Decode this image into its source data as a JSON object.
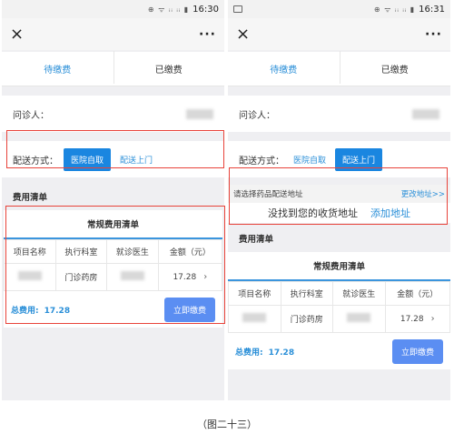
{
  "left": {
    "status": {
      "time": "16:30",
      "icons": "⊕ ᯤ ᵢᵢ ᵢᵢ ▮"
    },
    "nav": {
      "close": "×",
      "more": "···"
    },
    "tabs": [
      {
        "label": "待缴费"
      },
      {
        "label": "已缴费"
      }
    ],
    "patient_label": "问诊人：",
    "delivery": {
      "label": "配送方式：",
      "option_self": "医院自取",
      "option_home": "配送上门",
      "selected": "医院自取"
    },
    "section_title": "费用清单",
    "card_title": "常规费用清单",
    "table": {
      "headers": [
        "项目名称",
        "执行科室",
        "就诊医生",
        "金额（元）"
      ],
      "rows": [
        {
          "name": "",
          "dept": "门诊药房",
          "doctor": "",
          "amount": "17.28"
        }
      ]
    },
    "total": {
      "label": "总费用:",
      "value": "17.28"
    },
    "pay_button": "立即缴费"
  },
  "right": {
    "status": {
      "time": "16:31",
      "icons": "⊕ ᯤ ᵢᵢ ᵢᵢ ▮"
    },
    "nav": {
      "close": "×",
      "more": "···"
    },
    "tabs": [
      {
        "label": "待缴费"
      },
      {
        "label": "已缴费"
      }
    ],
    "patient_label": "问诊人：",
    "delivery": {
      "label": "配送方式：",
      "option_self": "医院自取",
      "option_home": "配送上门",
      "selected": "配送上门"
    },
    "address": {
      "prompt": "请选择药品配送地址",
      "change": "更改地址>>",
      "empty": "没找到您的收货地址",
      "add": "添加地址"
    },
    "section_title": "费用清单",
    "card_title": "常规费用清单",
    "table": {
      "headers": [
        "项目名称",
        "执行科室",
        "就诊医生",
        "金额（元）"
      ],
      "rows": [
        {
          "name": "",
          "dept": "门诊药房",
          "doctor": "",
          "amount": "17.28"
        }
      ]
    },
    "total": {
      "label": "总费用:",
      "value": "17.28"
    },
    "pay_button": "立即缴费"
  },
  "caption": "（图二十三）",
  "colors": {
    "accent": "#1a86e0",
    "link": "#2a8fd8",
    "highlight_border": "#e8433a",
    "pay_button": "#5b8ef2"
  }
}
